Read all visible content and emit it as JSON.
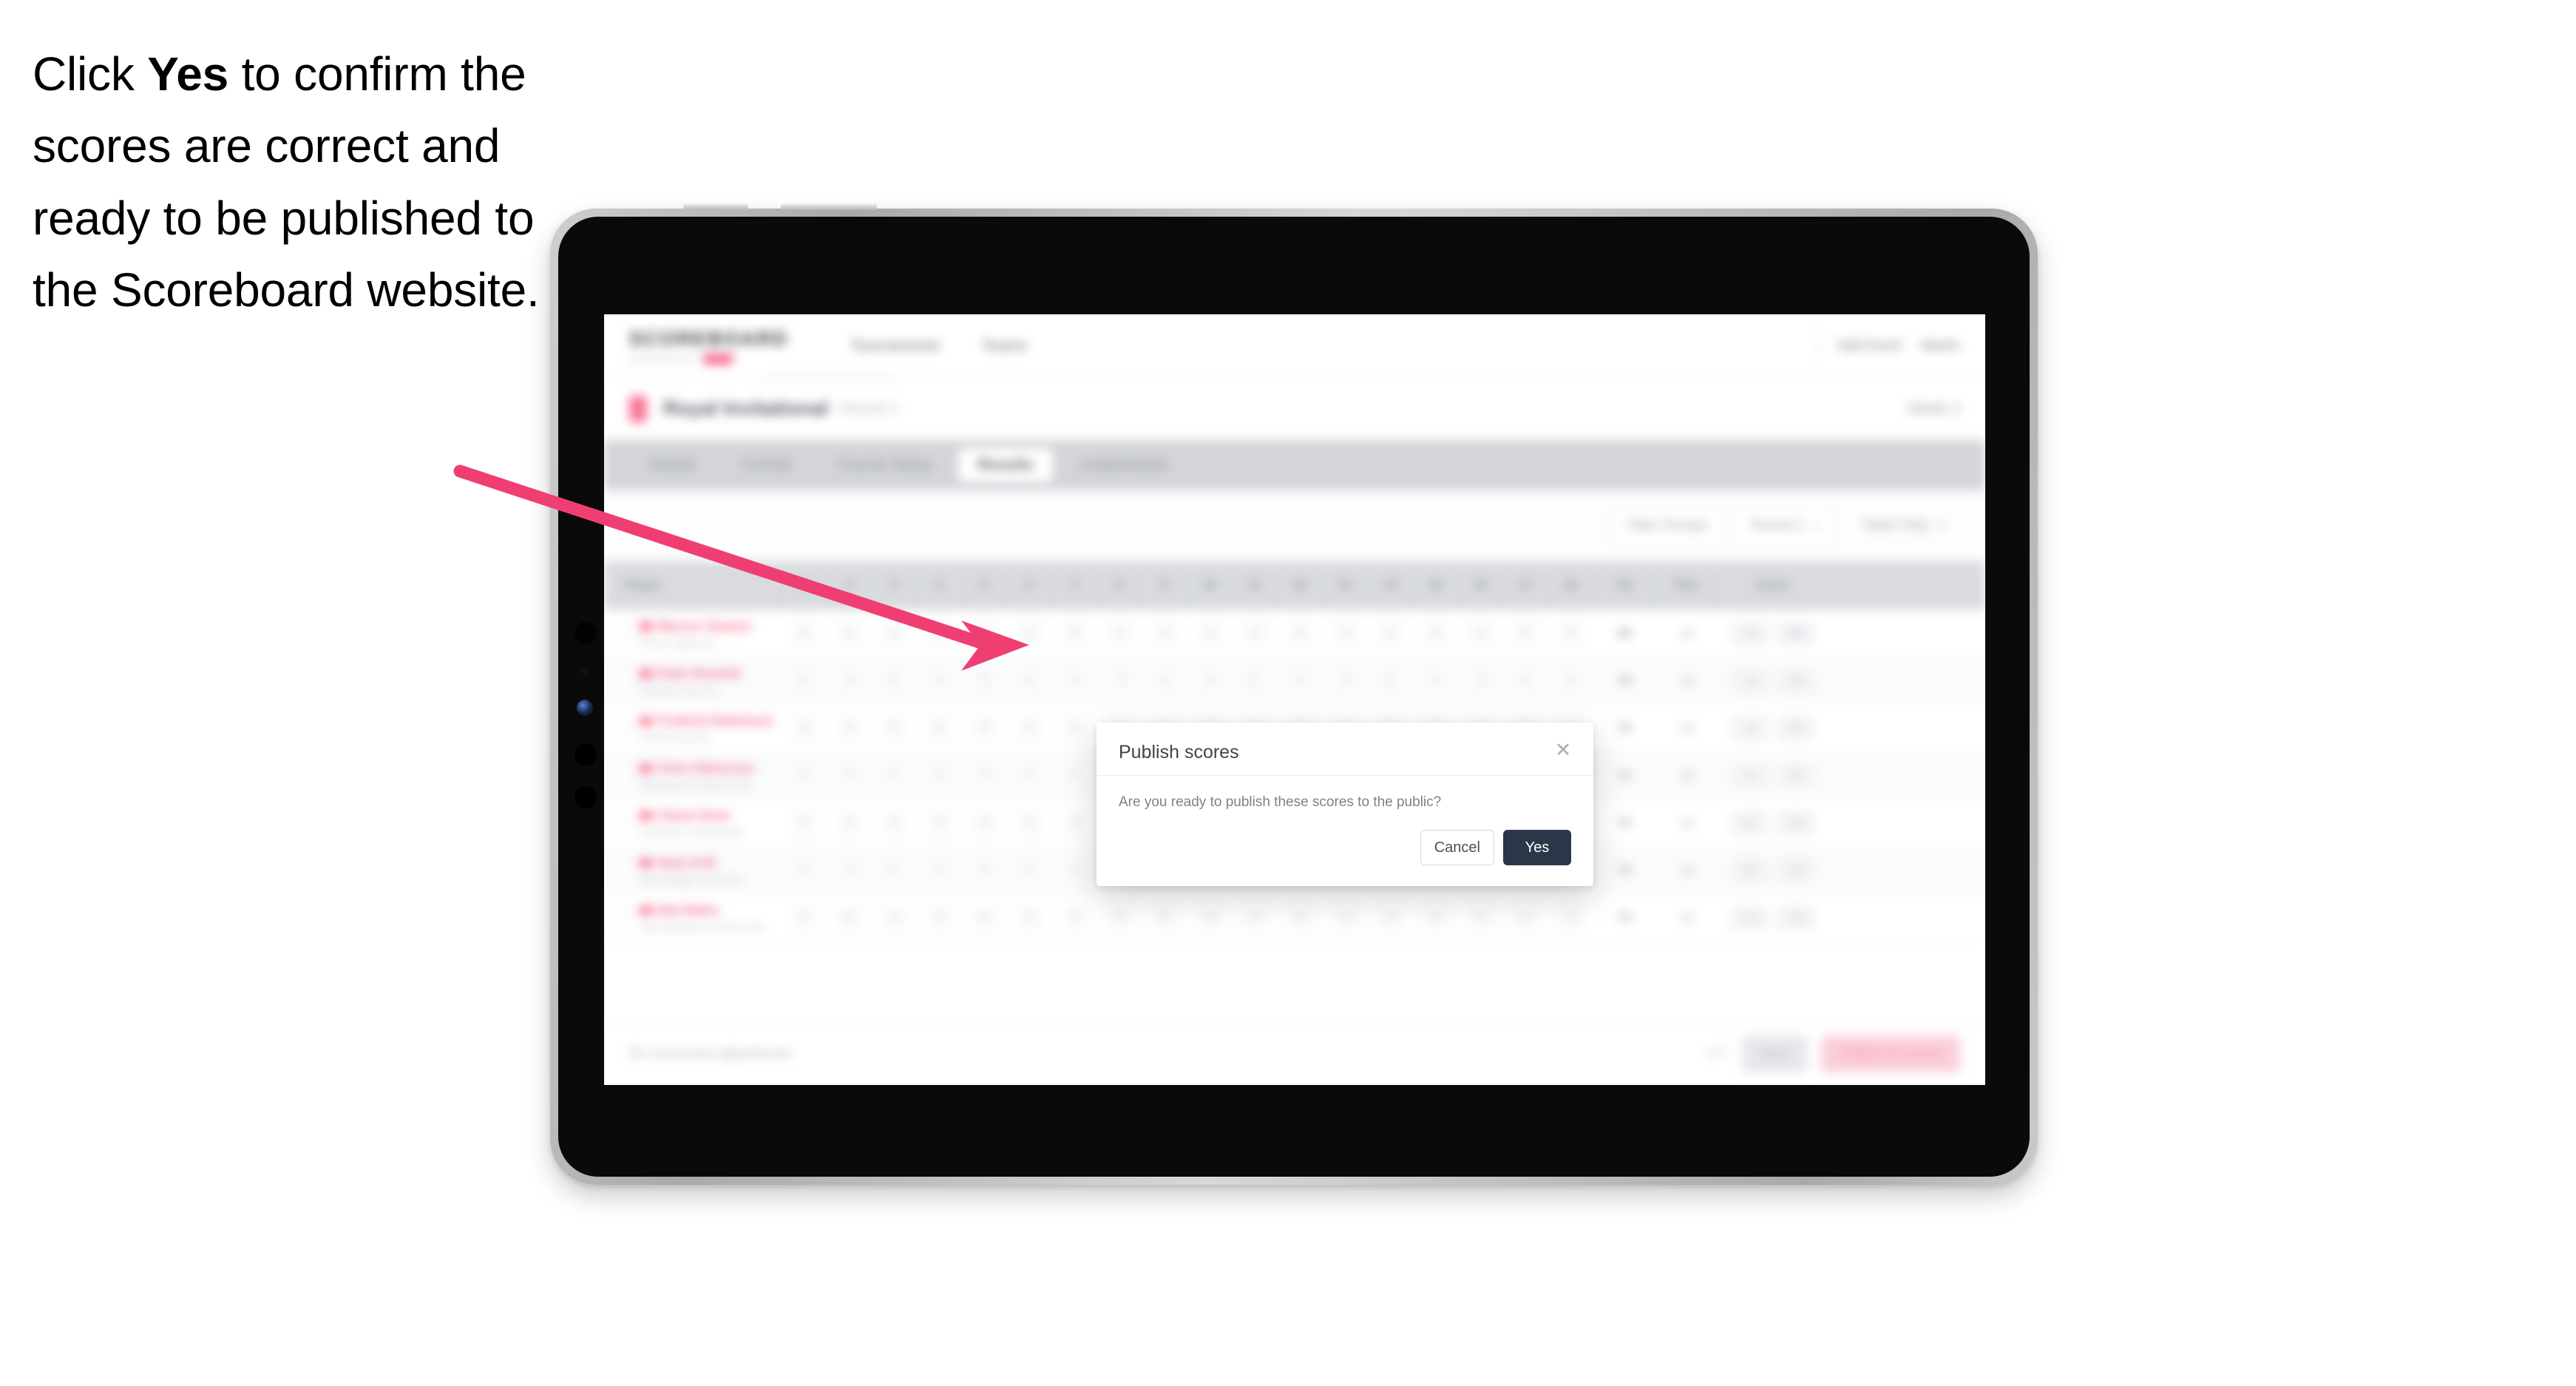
{
  "caption": {
    "before": "Click ",
    "bold": "Yes",
    "after": " to confirm the scores are correct and ready to be published to the Scoreboard website."
  },
  "colors": {
    "accent_pink": "#ef3f72",
    "brand_pink": "#f7577f",
    "yes_button": "#2b3648",
    "device_bezel": "#b9b9bb",
    "screen_black": "#0a0a0a"
  },
  "modal": {
    "title": "Publish scores",
    "body": "Are you ready to publish these scores to the public?",
    "close_icon": "close-icon",
    "cancel_label": "Cancel",
    "yes_label": "Yes"
  },
  "app": {
    "brand": {
      "word": "SCOREBOARD",
      "sub": "POWERED BY"
    },
    "header_nav": [
      {
        "label": "Tournaments"
      },
      {
        "label": "Teams"
      }
    ],
    "header_right": [
      {
        "label": "Add Event"
      },
      {
        "label": "Martin"
      }
    ],
    "event": {
      "title": "Royal Invitational",
      "sub": "Round 1",
      "right": "Week 3"
    },
    "tabs": [
      {
        "label": "Details"
      },
      {
        "label": "Format"
      },
      {
        "label": "Course Setup"
      },
      {
        "label": "Results"
      },
      {
        "label": "Leaderboard"
      }
    ],
    "active_tab_index": 3,
    "filters": [
      {
        "label": "Filter Groups"
      },
      {
        "label": "Round 1"
      },
      {
        "label": "Team Only"
      }
    ],
    "table": {
      "columns": [
        "Player",
        "1",
        "2",
        "3",
        "4",
        "5",
        "6",
        "7",
        "8",
        "9",
        "10",
        "11",
        "12",
        "13",
        "14",
        "15",
        "16",
        "17",
        "18",
        "Tot",
        "Thru",
        "Score"
      ],
      "rows": [
        {
          "name": "Marcus Tavares",
          "club": "Green Valley GC",
          "holes": [
            "4",
            "5",
            "3",
            "4",
            "4",
            "3",
            "5",
            "4",
            "4",
            "4",
            "3",
            "5",
            "4",
            "4",
            "3",
            "4",
            "5",
            "4"
          ],
          "tot": "69",
          "thru": "18",
          "score": [
            "-3",
            "69"
          ]
        },
        {
          "name": "Peter Rennick",
          "club": "Hazard Cove GC",
          "holes": [
            "5",
            "4",
            "3",
            "4",
            "5",
            "4",
            "4",
            "4",
            "3",
            "4",
            "4",
            "4",
            "5",
            "3",
            "4",
            "4",
            "4",
            "5"
          ],
          "tot": "70",
          "thru": "18",
          "score": [
            "-2",
            "70"
          ]
        },
        {
          "name": "Fredrick Robertson",
          "club": "Pinehurst Links",
          "holes": [
            "4",
            "4",
            "4",
            "5",
            "4",
            "3",
            "4",
            "5",
            "4",
            "4",
            "3",
            "4",
            "4",
            "5",
            "4",
            "3",
            "5",
            "4"
          ],
          "tot": "70",
          "thru": "18",
          "score": [
            "-2",
            "70"
          ]
        },
        {
          "name": "Chris Halvorson",
          "club": "Birchwood Country Club",
          "holes": [
            "4",
            "5",
            "4",
            "4",
            "3",
            "4",
            "5",
            "4",
            "4",
            "3",
            "4",
            "5",
            "4",
            "4",
            "4",
            "4",
            "3",
            "5"
          ],
          "tot": "71",
          "thru": "18",
          "score": [
            "-1",
            "71"
          ]
        },
        {
          "name": "Chase Dunn",
          "club": "Lakeshore Golf Resort",
          "holes": [
            "5",
            "4",
            "4",
            "3",
            "4",
            "5",
            "4",
            "4",
            "4",
            "4",
            "5",
            "3",
            "4",
            "4",
            "5",
            "4",
            "4",
            "4"
          ],
          "tot": "72",
          "thru": "18",
          "score": [
            "E",
            "72"
          ]
        },
        {
          "name": "Sean Krill",
          "club": "Stonebridge Golf Club",
          "holes": [
            "4",
            "4",
            "5",
            "4",
            "4",
            "4",
            "3",
            "5",
            "4",
            "5",
            "4",
            "4",
            "4",
            "3",
            "4",
            "5",
            "4",
            "4"
          ],
          "tot": "72",
          "thru": "18",
          "score": [
            "E",
            "72"
          ]
        },
        {
          "name": "Bob Bates",
          "club": "Oak Meadow Country Club",
          "holes": [
            "4",
            "5",
            "4",
            "4",
            "4",
            "3",
            "5",
            "4",
            "5",
            "4",
            "4",
            "4",
            "4",
            "4",
            "3",
            "5",
            "4",
            "4"
          ],
          "tot": "73",
          "thru": "18",
          "score": [
            "+1",
            "73"
          ]
        }
      ]
    },
    "footer": {
      "note": "No scorecard adjustments",
      "small": "of 7",
      "grey_button": "Save",
      "pink_button": "Publish all scores"
    }
  }
}
